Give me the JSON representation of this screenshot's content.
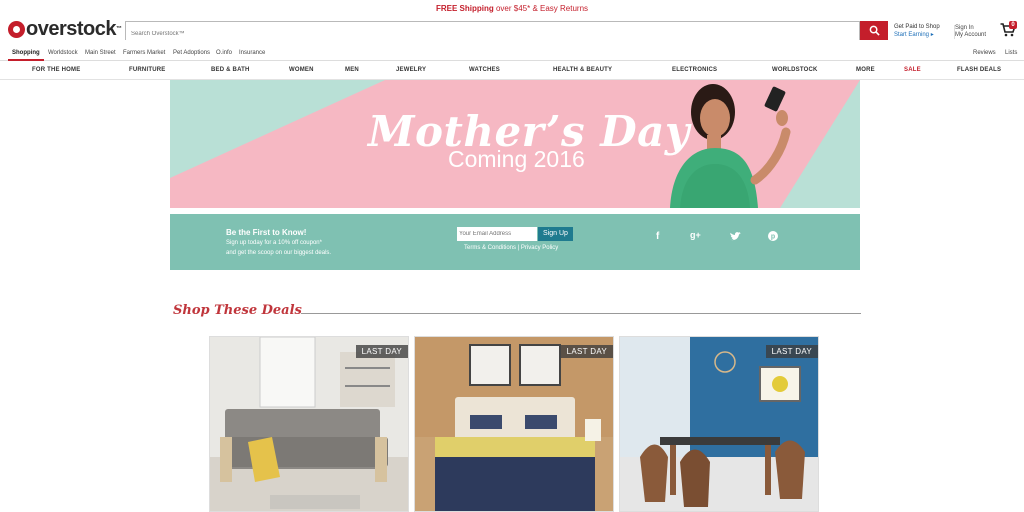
{
  "promo": {
    "free_shipping": "FREE Shipping",
    "rest": " over $45* & Easy Returns"
  },
  "header": {
    "logo": "overstock",
    "logo_tm": "™",
    "search_placeholder": "Search Overstock™",
    "get_paid": "Get Paid to Shop",
    "start_earning": "Start Earning",
    "sign_in": "Sign In",
    "my_account": "My Account",
    "cart_count": "0"
  },
  "subnav": {
    "items": [
      "Shopping",
      "Worldstock",
      "Main Street",
      "Farmers Market",
      "Pet Adoptions",
      "O.info",
      "Insurance"
    ],
    "right": [
      "Reviews",
      "Lists"
    ]
  },
  "catnav": [
    "FOR THE HOME",
    "FURNITURE",
    "BED & BATH",
    "WOMEN",
    "MEN",
    "JEWELRY",
    "WATCHES",
    "HEALTH & BEAUTY",
    "ELECTRONICS",
    "WORLDSTOCK",
    "MORE",
    "SALE",
    "FLASH DEALS"
  ],
  "hero": {
    "title": "Mother’s Day",
    "subtitle": "Coming 2016"
  },
  "newsletter": {
    "heading": "Be the First to Know!",
    "line1": "Sign up today for a 10% off coupon*",
    "line2": "and get the scoop on our biggest deals.",
    "email_placeholder": "Your Email Address",
    "signup": "Sign Up",
    "terms": "Terms & Conditions | Privacy Policy",
    "social": [
      "f",
      "g+",
      "twitter",
      "pinterest"
    ]
  },
  "deals": {
    "heading": "Shop These Deals",
    "cards": [
      {
        "badge": "LAST DAY"
      },
      {
        "badge": "LAST DAY"
      },
      {
        "badge": "LAST DAY"
      }
    ]
  },
  "colors": {
    "brand_red": "#c41e2b",
    "hero_pink": "#f6b8c3",
    "hero_mint": "#b9e0d6",
    "news_teal": "#7fc1b2",
    "signup_blue": "#1f7b8f"
  }
}
